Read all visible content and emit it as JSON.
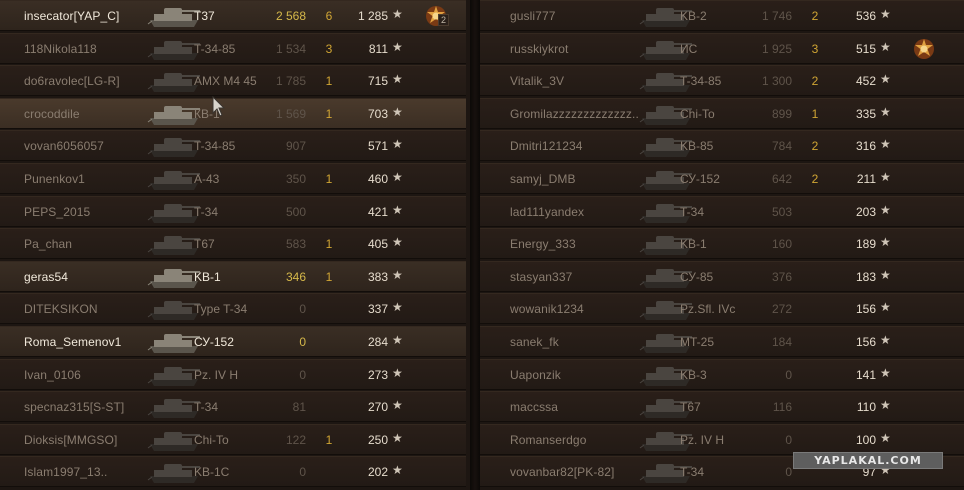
{
  "left_team": [
    {
      "player": "insecator[YAP_C]",
      "vehicle": "T37",
      "damage": "2 568",
      "frags": "6",
      "xp": "1 285",
      "state": "alive",
      "medal": "rank-medal-icon",
      "medal_count": "2"
    },
    {
      "player": "118Nikola118",
      "vehicle": "T-34-85",
      "damage": "1 534",
      "frags": "3",
      "xp": "811",
      "state": "dead"
    },
    {
      "player": "do6ravolec[LG-R]",
      "vehicle": "AMX M4 45",
      "damage": "1 785",
      "frags": "1",
      "xp": "715",
      "state": "dead"
    },
    {
      "player": "crocoddile",
      "vehicle": "КВ-1",
      "damage": "1 569",
      "frags": "1",
      "xp": "703",
      "state": "hover"
    },
    {
      "player": "vovan6056057",
      "vehicle": "T-34-85",
      "damage": "907",
      "frags": "",
      "xp": "571",
      "state": "dead"
    },
    {
      "player": "Punenkov1",
      "vehicle": "A-43",
      "damage": "350",
      "frags": "1",
      "xp": "460",
      "state": "dead"
    },
    {
      "player": "PEPS_2015",
      "vehicle": "T-34",
      "damage": "500",
      "frags": "",
      "xp": "421",
      "state": "dead"
    },
    {
      "player": "Pa_chan",
      "vehicle": "T67",
      "damage": "583",
      "frags": "1",
      "xp": "405",
      "state": "dead"
    },
    {
      "player": "geras54",
      "vehicle": "KB-1",
      "damage": "346",
      "frags": "1",
      "xp": "383",
      "state": "alive"
    },
    {
      "player": "DITEKSIKON",
      "vehicle": "Type T-34",
      "damage": "0",
      "frags": "",
      "xp": "337",
      "state": "dead"
    },
    {
      "player": "Roma_Semenov1",
      "vehicle": "СУ-152",
      "damage": "0",
      "frags": "",
      "xp": "284",
      "state": "alive"
    },
    {
      "player": "Ivan_0106",
      "vehicle": "Pz. IV H",
      "damage": "0",
      "frags": "",
      "xp": "273",
      "state": "dead"
    },
    {
      "player": "specnaz315[S-ST]",
      "vehicle": "T-34",
      "damage": "81",
      "frags": "",
      "xp": "270",
      "state": "dead"
    },
    {
      "player": "Dioksis[MMGSO]",
      "vehicle": "Chi-To",
      "damage": "122",
      "frags": "1",
      "xp": "250",
      "state": "dead"
    },
    {
      "player": "Islam1997_13..",
      "vehicle": "KB-1C",
      "damage": "0",
      "frags": "",
      "xp": "202",
      "state": "dead"
    }
  ],
  "right_team": [
    {
      "player": "gusli777",
      "vehicle": "KB-2",
      "damage": "1 746",
      "frags": "2",
      "xp": "536",
      "state": "dead"
    },
    {
      "player": "russkiykrot",
      "vehicle": "ИС",
      "damage": "1 925",
      "frags": "3",
      "xp": "515",
      "state": "dead",
      "medal": "rank-medal-icon"
    },
    {
      "player": "Vitalik_3V",
      "vehicle": "T-34-85",
      "damage": "1 300",
      "frags": "2",
      "xp": "452",
      "state": "dead"
    },
    {
      "player": "Gromilazzzzzzzzzzzzz..",
      "vehicle": "Chi-To",
      "damage": "899",
      "frags": "1",
      "xp": "335",
      "state": "dead"
    },
    {
      "player": "Dmitri121234",
      "vehicle": "KB-85",
      "damage": "784",
      "frags": "2",
      "xp": "316",
      "state": "dead"
    },
    {
      "player": "samyj_DMB",
      "vehicle": "СУ-152",
      "damage": "642",
      "frags": "2",
      "xp": "211",
      "state": "dead"
    },
    {
      "player": "lad111yandex",
      "vehicle": "T-34",
      "damage": "503",
      "frags": "",
      "xp": "203",
      "state": "dead"
    },
    {
      "player": "Energy_333",
      "vehicle": "KB-1",
      "damage": "160",
      "frags": "",
      "xp": "189",
      "state": "dead"
    },
    {
      "player": "stasyan337",
      "vehicle": "СУ-85",
      "damage": "376",
      "frags": "",
      "xp": "183",
      "state": "dead"
    },
    {
      "player": "wowanik1234",
      "vehicle": "Pz.Sfl. IVc",
      "damage": "272",
      "frags": "",
      "xp": "156",
      "state": "dead"
    },
    {
      "player": "sanek_fk",
      "vehicle": "MT-25",
      "damage": "184",
      "frags": "",
      "xp": "156",
      "state": "dead"
    },
    {
      "player": "Uaponzik",
      "vehicle": "KB-3",
      "damage": "0",
      "frags": "",
      "xp": "141",
      "state": "dead"
    },
    {
      "player": "maccssa",
      "vehicle": "T67",
      "damage": "116",
      "frags": "",
      "xp": "110",
      "state": "dead"
    },
    {
      "player": "Romanserdgo",
      "vehicle": "Pz. IV H",
      "damage": "0",
      "frags": "",
      "xp": "100",
      "state": "dead"
    },
    {
      "player": "vovanbar82[PK-82]",
      "vehicle": "T-34",
      "damage": "0",
      "frags": "",
      "xp": "97",
      "state": "dead"
    }
  ],
  "star_glyph": "★",
  "watermark": "YAPLAKAL.COM",
  "colors": {
    "background": "#1d1612",
    "frags": "#d0a534",
    "alive_text": "#f0e8da",
    "dead_text": "#8a7d70"
  }
}
